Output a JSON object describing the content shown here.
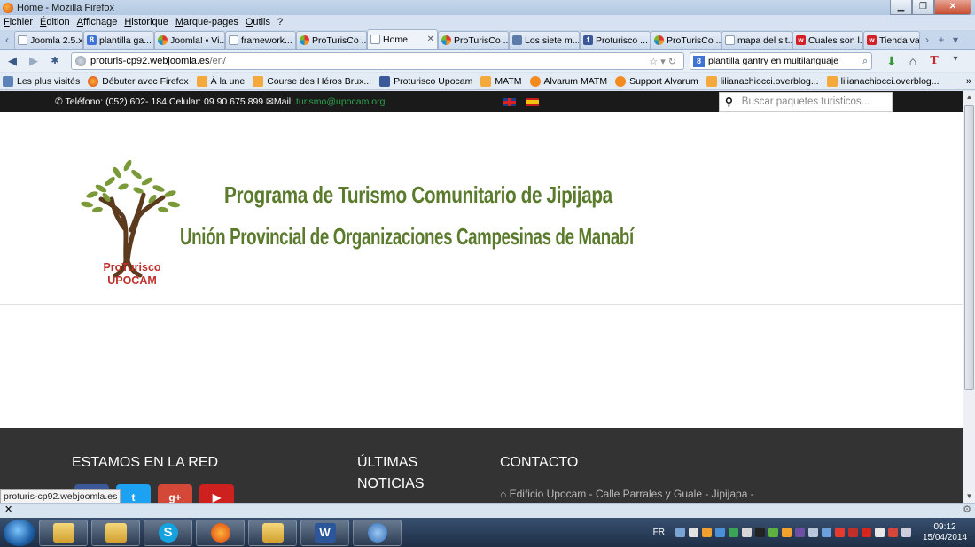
{
  "window": {
    "title": "Home - Mozilla Firefox"
  },
  "menu": [
    "Fichier",
    "Édition",
    "Affichage",
    "Historique",
    "Marque-pages",
    "Outils",
    "?"
  ],
  "tabs": [
    {
      "label": "Joomla 2.5.x...",
      "icon": "page"
    },
    {
      "label": "plantilla ga...",
      "icon": "google"
    },
    {
      "label": "Joomla! • Vi...",
      "icon": "joomla"
    },
    {
      "label": "framework...",
      "icon": "page"
    },
    {
      "label": "ProTurisCo ...",
      "icon": "joomla"
    },
    {
      "label": "Home",
      "icon": "page",
      "active": true
    },
    {
      "label": "ProTurisCo ...",
      "icon": "joomla"
    },
    {
      "label": "Los siete m...",
      "icon": "arrow"
    },
    {
      "label": "Proturisco ...",
      "icon": "fb"
    },
    {
      "label": "ProTurisCo ...",
      "icon": "joomla"
    },
    {
      "label": "mapa del sit...",
      "icon": "page"
    },
    {
      "label": "Cuales son l...",
      "icon": "w"
    },
    {
      "label": "Tienda var",
      "icon": "w"
    }
  ],
  "nav": {
    "url_host": "proturis-cp92.webjoomla.es",
    "url_path": "/en/",
    "search_engine_icon": "google-icon",
    "search_value": "plantilla gantry en multilanguaje"
  },
  "bookmarks": [
    {
      "label": "Les plus visités",
      "icon": "list"
    },
    {
      "label": "Débuter avec Firefox",
      "icon": "ff"
    },
    {
      "label": "À la une",
      "icon": "rss"
    },
    {
      "label": "Course des Héros Brux...",
      "icon": "rss"
    },
    {
      "label": "Proturisco Upocam",
      "icon": "fb"
    },
    {
      "label": "MATM",
      "icon": "rss"
    },
    {
      "label": "Alvarum MATM",
      "icon": "alv"
    },
    {
      "label": "Support Alvarum",
      "icon": "alv"
    },
    {
      "label": "lilianachiocci.overblog...",
      "icon": "rss"
    },
    {
      "label": "lilianachiocci.overblog...",
      "icon": "rss"
    }
  ],
  "site": {
    "contact_phone": "Teléfono: (052) 602- 184  Celular: 09 90 675 899",
    "contact_mail_label": "Mail: ",
    "contact_mail": "turismo@upocam.org",
    "search_placeholder": "Buscar paquetes turisticos...",
    "logo_line1": "ProTurisco",
    "logo_line2": "UPOCAM",
    "heading1": "Programa de Turismo Comunitario de Jipijapa",
    "heading2": "Unión Provincial de Organizaciones Campesinas de Manabí",
    "footer": {
      "col1_title": "ESTAMOS EN LA RED",
      "col2_title_a": "ÚLTIMAS",
      "col2_title_b": "NOTICIAS",
      "col3_title": "CONTACTO",
      "address": "Edificio Upocam - Calle Parrales y Guale - Jipijapa -"
    }
  },
  "status_tip": "proturis-cp92.webjoomla.es",
  "taskbar": {
    "lang": "FR",
    "time": "09:12",
    "date": "15/04/2014"
  },
  "colors": {
    "heading_green": "#5a7b2c",
    "logo_red": "#c0302b",
    "mail_green": "#2ca24f",
    "footer_bg": "#333333"
  }
}
